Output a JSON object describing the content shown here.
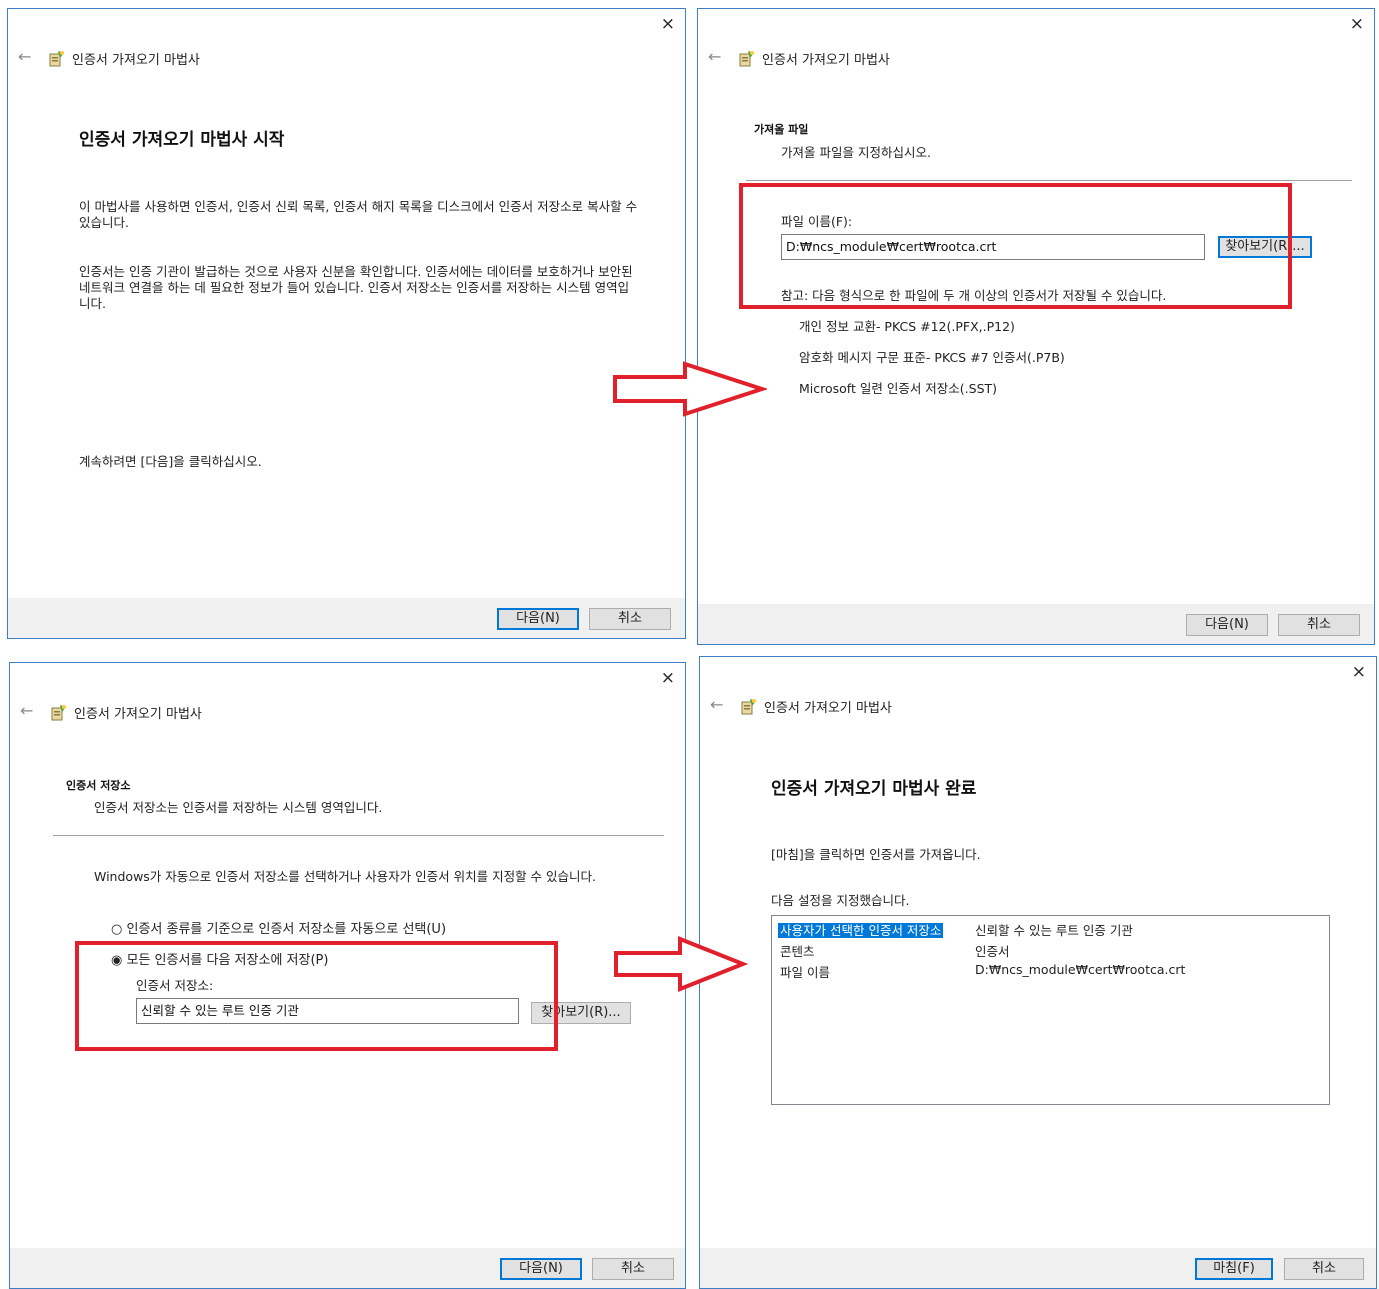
{
  "common": {
    "close_glyph": "×",
    "back_glyph": "←",
    "wizard_title": "인증서 가져오기 마법사",
    "next_label": "다음(N)",
    "cancel_label": "취소"
  },
  "step1": {
    "heading": "인증서 가져오기 마법사 시작",
    "para1": "이 마법사를 사용하면 인증서, 인증서 신뢰 목록, 인증서 해지 목록을 디스크에서 인증서 저장소로 복사할 수 있습니다.",
    "para2": "인증서는 인증 기관이 발급하는 것으로 사용자 신분을 확인합니다. 인증서에는 데이터를 보호하거나 보안된 네트워크 연결을 하는 데 필요한 정보가 들어 있습니다. 인증서 저장소는 인증서를 저장하는 시스템 영역입니다.",
    "continue_text": "계속하려면 [다음]을 클릭하십시오."
  },
  "step2": {
    "section_title": "가져올 파일",
    "section_desc": "가져올 파일을 지정하십시오.",
    "file_label": "파일 이름(F):",
    "file_value": "D:₩ncs_module₩cert₩rootca.crt",
    "browse_label": "찾아보기(R)...",
    "note": "참고: 다음 형식으로 한 파일에 두 개 이상의 인증서가 저장될 수 있습니다.",
    "formats": [
      "개인 정보 교환- PKCS #12(.PFX,.P12)",
      "암호화 메시지 구문 표준- PKCS #7 인증서(.P7B)",
      "Microsoft 일련 인증서 저장소(.SST)"
    ]
  },
  "step3": {
    "section_title": "인증서 저장소",
    "section_desc": "인증서 저장소는 인증서를 저장하는 시스템 영역입니다.",
    "intro": "Windows가 자동으로 인증서 저장소를 선택하거나 사용자가 인증서 위치를 지정할 수 있습니다.",
    "radio_auto": "인증서 종류를 기준으로 인증서 저장소를 자동으로 선택(U)",
    "radio_manual": "모든 인증서를 다음 저장소에 저장(P)",
    "selected_option": "manual",
    "store_label": "인증서 저장소:",
    "store_value": "신뢰할 수 있는 루트 인증 기관",
    "browse_label": "찾아보기(R)..."
  },
  "step4": {
    "heading": "인증서 가져오기 마법사 완료",
    "finish_text": "[마침]을 클릭하면 인증서를 가져옵니다.",
    "settings_label": "다음 설정을 지정했습니다.",
    "rows": [
      {
        "key": "사용자가 선택한 인증서 저장소",
        "value": "신뢰할 수 있는 루트 인증 기관"
      },
      {
        "key": "콘텐츠",
        "value": "인증서"
      },
      {
        "key": "파일 이름",
        "value": "D:₩ncs_module₩cert₩rootca.crt"
      }
    ],
    "finish_label": "마침(F)"
  },
  "colors": {
    "highlight_red": "#e0202a",
    "accent_blue": "#0078d7"
  }
}
